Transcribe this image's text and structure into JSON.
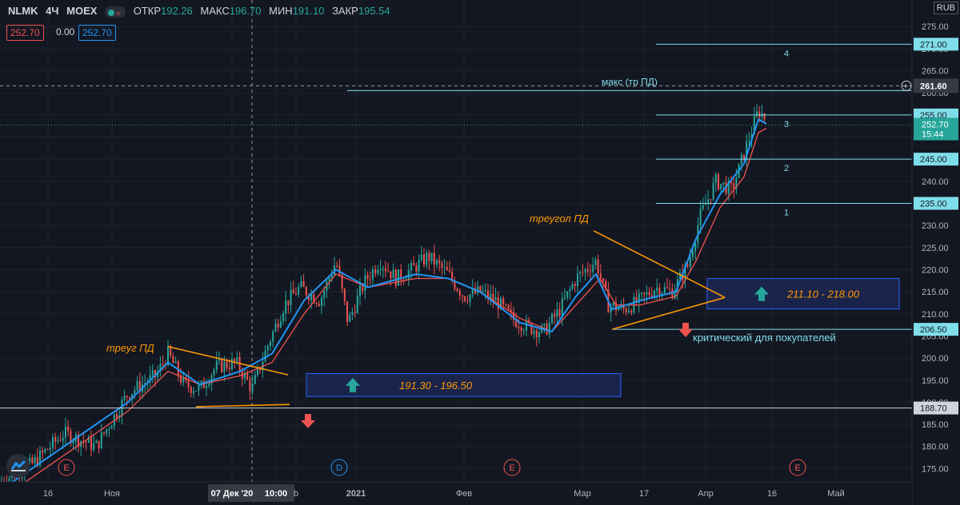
{
  "header": {
    "symbol": "NLMK",
    "interval": "4Ч",
    "exchange": "MOEX",
    "open_label": "ОТКР",
    "open": "192.26",
    "high_label": "МАКС",
    "high": "196.70",
    "low_label": "МИН",
    "low": "191.10",
    "close_label": "ЗАКР",
    "close": "195.54",
    "sell_price": "252.70",
    "spread": "0.00",
    "buy_price": "252.70",
    "currency": "RUB"
  },
  "colors": {
    "bg": "#131722",
    "up": "#26a69a",
    "down": "#ef5350",
    "line_blue": "#2196f3",
    "line_red": "#ef5350",
    "level": "#80deea",
    "trend": "#ff9800",
    "zone": "#1e2a5a"
  },
  "chart_data": {
    "type": "candlestick",
    "ylim": [
      172,
      281
    ],
    "y_ticks": [
      "175.00",
      "180.00",
      "185.00",
      "190.00",
      "195.00",
      "200.00",
      "205.00",
      "210.00",
      "215.00",
      "220.00",
      "225.00",
      "230.00",
      "235.00",
      "240.00",
      "245.00",
      "250.00",
      "255.00",
      "260.00",
      "265.00",
      "270.00",
      "275.00"
    ],
    "x_ticks": [
      "16",
      "Ноя",
      "07 Дек '20",
      "10:00",
      "b",
      "2021",
      "Фев",
      "Мар",
      "17",
      "Апр",
      "16",
      "Май"
    ],
    "price_path": [
      [
        0,
        172
      ],
      [
        40,
        176
      ],
      [
        80,
        183
      ],
      [
        120,
        180
      ],
      [
        160,
        192
      ],
      [
        195,
        196
      ],
      [
        210,
        201
      ],
      [
        230,
        194
      ],
      [
        250,
        193
      ],
      [
        270,
        198
      ],
      [
        295,
        199
      ],
      [
        315,
        193
      ],
      [
        335,
        203
      ],
      [
        355,
        212
      ],
      [
        375,
        216
      ],
      [
        400,
        213
      ],
      [
        420,
        222
      ],
      [
        435,
        208
      ],
      [
        455,
        217
      ],
      [
        475,
        222
      ],
      [
        495,
        218
      ],
      [
        515,
        220
      ],
      [
        535,
        223
      ],
      [
        560,
        219
      ],
      [
        580,
        214
      ],
      [
        600,
        215
      ],
      [
        620,
        213
      ],
      [
        640,
        209
      ],
      [
        660,
        207
      ],
      [
        680,
        206
      ],
      [
        700,
        211
      ],
      [
        720,
        218
      ],
      [
        745,
        222
      ],
      [
        760,
        212
      ],
      [
        780,
        211
      ],
      [
        800,
        213
      ],
      [
        820,
        216
      ],
      [
        840,
        215
      ],
      [
        860,
        221
      ],
      [
        875,
        232
      ],
      [
        895,
        240
      ],
      [
        915,
        238
      ],
      [
        935,
        249
      ],
      [
        948,
        256
      ],
      [
        958,
        254
      ]
    ],
    "ma_blue": [
      [
        0,
        170
      ],
      [
        80,
        180
      ],
      [
        160,
        190
      ],
      [
        210,
        199
      ],
      [
        250,
        194
      ],
      [
        300,
        197
      ],
      [
        340,
        201
      ],
      [
        380,
        213
      ],
      [
        420,
        220
      ],
      [
        460,
        216
      ],
      [
        520,
        219
      ],
      [
        560,
        218
      ],
      [
        600,
        215
      ],
      [
        650,
        208
      ],
      [
        690,
        206
      ],
      [
        720,
        214
      ],
      [
        745,
        219
      ],
      [
        765,
        211
      ],
      [
        800,
        213
      ],
      [
        845,
        215
      ],
      [
        870,
        227
      ],
      [
        900,
        237
      ],
      [
        930,
        244
      ],
      [
        948,
        254
      ],
      [
        958,
        253
      ]
    ],
    "ma_red": [
      [
        0,
        168
      ],
      [
        80,
        178
      ],
      [
        160,
        188
      ],
      [
        210,
        197
      ],
      [
        250,
        194
      ],
      [
        300,
        196
      ],
      [
        340,
        199
      ],
      [
        380,
        210
      ],
      [
        420,
        219
      ],
      [
        460,
        216
      ],
      [
        520,
        218
      ],
      [
        560,
        218
      ],
      [
        600,
        215
      ],
      [
        650,
        209
      ],
      [
        690,
        206
      ],
      [
        720,
        212
      ],
      [
        750,
        218
      ],
      [
        770,
        212
      ],
      [
        800,
        212
      ],
      [
        845,
        214
      ],
      [
        870,
        222
      ],
      [
        900,
        234
      ],
      [
        930,
        241
      ],
      [
        948,
        251
      ],
      [
        958,
        252
      ]
    ],
    "levels": [
      {
        "value": 271.0,
        "label": "271.00",
        "number": "4"
      },
      {
        "value": 255.0,
        "label": "255.00",
        "number": "3"
      },
      {
        "value": 245.0,
        "label": "245.00",
        "number": "2"
      },
      {
        "value": 235.0,
        "label": "235.00",
        "number": "1"
      },
      {
        "value": 206.5,
        "label": "206.50",
        "number": ""
      },
      {
        "value": 188.7,
        "label": "188.70",
        "number": ""
      }
    ],
    "max_level": {
      "value": 260.5,
      "text": "макс (тр ПД)"
    },
    "crosshair_price": "261.60",
    "current_price": "252.70",
    "current_time": "15:44",
    "triangles": [
      {
        "label": "треуг ПД",
        "upper": [
          [
            210,
            202.6
          ],
          [
            360,
            196.2
          ]
        ],
        "lower": [
          [
            245,
            189.0
          ],
          [
            362,
            189.5
          ]
        ]
      },
      {
        "label": "треугол ПД",
        "upper": [
          [
            742,
            228.8
          ],
          [
            906,
            213.7
          ]
        ],
        "lower": [
          [
            765,
            206.5
          ],
          [
            906,
            213.7
          ]
        ]
      }
    ],
    "zones": [
      {
        "text": "191.30 - 196.50",
        "y1": 196.5,
        "y2": 191.3
      },
      {
        "text": "211.10 - 218.00",
        "y1": 218.0,
        "y2": 211.1
      }
    ],
    "critical_label": "критический для покупателей",
    "event_markers": [
      {
        "glyph": "E"
      },
      {
        "glyph": "D"
      },
      {
        "glyph": "E"
      },
      {
        "glyph": "E"
      }
    ]
  }
}
